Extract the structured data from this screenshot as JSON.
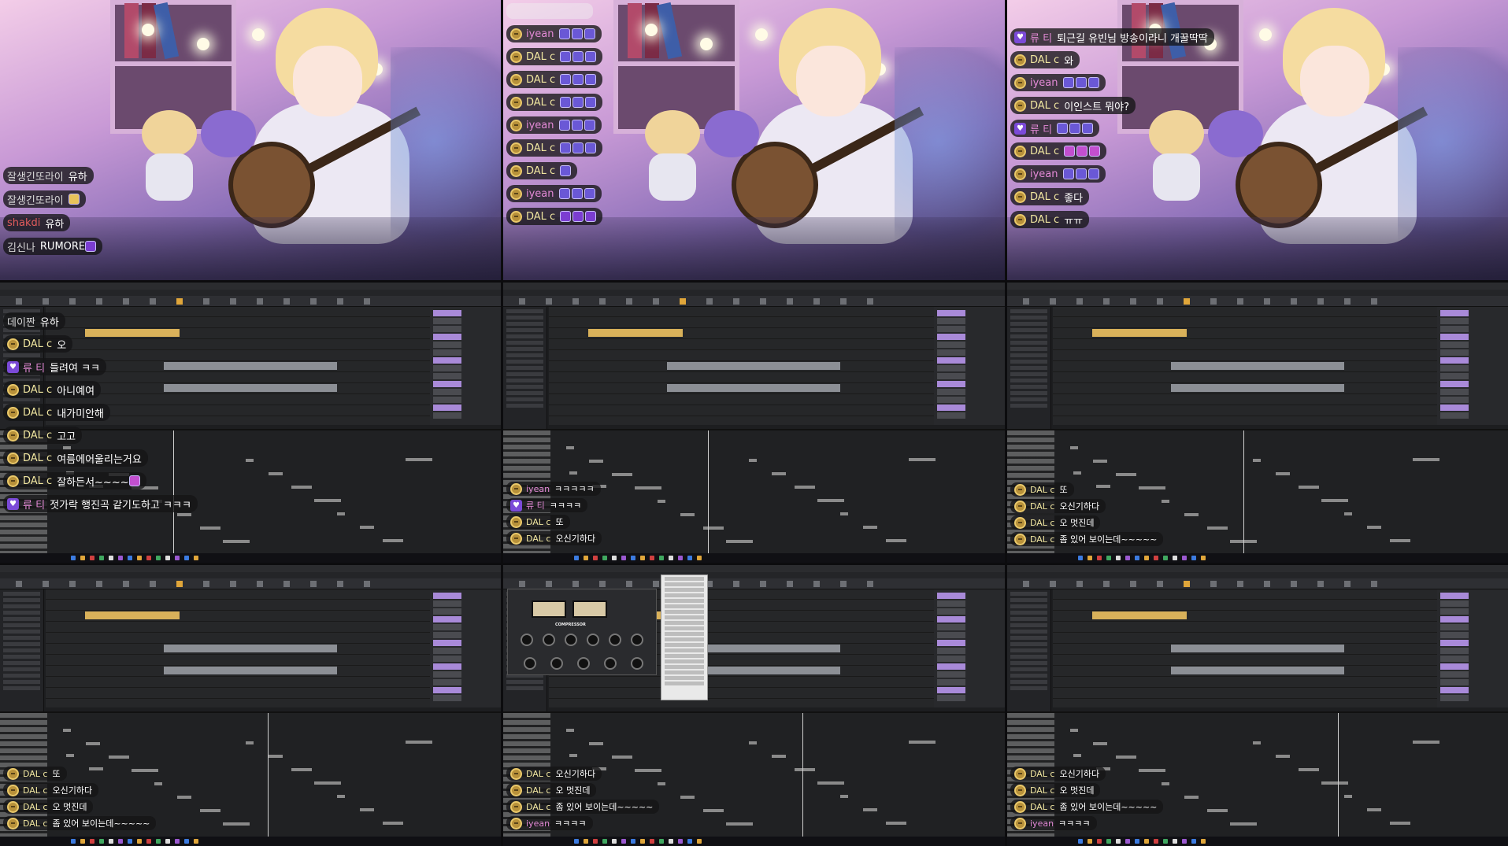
{
  "tiles": {
    "t1": {
      "chat": [
        {
          "nick": "잘생긴또라이",
          "text": "유하",
          "nick_color": "white"
        },
        {
          "nick": "잘생긴또라이",
          "text": "",
          "nick_color": "white",
          "emotes": [
            "yellow"
          ]
        },
        {
          "nick": "shakdi",
          "text": "유하",
          "nick_color": "red"
        },
        {
          "nick": "김신나",
          "text": "RUMORE",
          "nick_color": "white",
          "emotes": [
            "purple2"
          ]
        }
      ]
    },
    "t2": {
      "chat": [
        {
          "nick": "iyean",
          "text": "",
          "badge": true,
          "nick_color": "pink",
          "emotes": [
            "blue",
            "blue",
            "blue"
          ]
        },
        {
          "nick": "DAL c",
          "text": "",
          "badge": true,
          "emotes": [
            "blue",
            "blue",
            "blue"
          ]
        },
        {
          "nick": "DAL c",
          "text": "",
          "badge": true,
          "emotes": [
            "blue",
            "blue",
            "blue"
          ]
        },
        {
          "nick": "DAL c",
          "text": "",
          "badge": true,
          "emotes": [
            "blue",
            "blue",
            "blue"
          ]
        },
        {
          "nick": "iyean",
          "text": "",
          "badge": true,
          "nick_color": "pink",
          "emotes": [
            "blue",
            "blue",
            "blue"
          ]
        },
        {
          "nick": "DAL c",
          "text": "",
          "badge": true,
          "emotes": [
            "blue",
            "blue",
            "blue"
          ]
        },
        {
          "nick": "DAL c",
          "text": "",
          "badge": true,
          "emotes": [
            "blue"
          ]
        },
        {
          "nick": "iyean",
          "text": "",
          "badge": true,
          "nick_color": "pink",
          "emotes": [
            "blue",
            "blue",
            "blue"
          ]
        },
        {
          "nick": "DAL c",
          "text": "",
          "badge": true,
          "emotes": [
            "purple2",
            "purple2",
            "purple2"
          ]
        }
      ]
    },
    "t3": {
      "chat": [
        {
          "nick": "류 티",
          "text": "퇴근길 유빈님 방송이라니 개꿀딱딱",
          "heart": true,
          "nick_color": "pink"
        },
        {
          "nick": "DAL c",
          "text": "와",
          "badge": true
        },
        {
          "nick": "iyean",
          "text": "",
          "badge": true,
          "nick_color": "pink",
          "emotes": [
            "blue",
            "blue",
            "blue"
          ]
        },
        {
          "nick": "DAL c",
          "text": "이인스트 뭐야?",
          "badge": true
        },
        {
          "nick": "류 티",
          "text": "",
          "heart": true,
          "nick_color": "pink",
          "emotes": [
            "blue",
            "blue",
            "blue"
          ]
        },
        {
          "nick": "DAL c",
          "text": "",
          "badge": true,
          "emotes": [
            "pink",
            "pink",
            "pink"
          ]
        },
        {
          "nick": "iyean",
          "text": "",
          "badge": true,
          "nick_color": "pink",
          "emotes": [
            "blue",
            "blue",
            "blue"
          ]
        },
        {
          "nick": "DAL c",
          "text": "좋다",
          "badge": true
        },
        {
          "nick": "DAL c",
          "text": "ㅠㅠ",
          "badge": true
        }
      ]
    },
    "t4": {
      "chat": [
        {
          "nick": "데이짠",
          "text": "유하",
          "nick_color": "white"
        },
        {
          "nick": "DAL c",
          "text": "오",
          "badge": true
        },
        {
          "nick": "류 티",
          "text": "들려여 ㅋㅋ",
          "heart": true,
          "nick_color": "pink"
        },
        {
          "nick": "DAL c",
          "text": "아니예여",
          "badge": true
        },
        {
          "nick": "DAL c",
          "text": "내가미안해",
          "badge": true
        },
        {
          "nick": "DAL c",
          "text": "고고",
          "badge": true
        },
        {
          "nick": "DAL c",
          "text": "여름에어울리는거요",
          "badge": true
        },
        {
          "nick": "DAL c",
          "text": "잘하든서~~~~",
          "badge": true,
          "emotes": [
            "pink"
          ]
        },
        {
          "nick": "류 티",
          "text": "젓가락 행진곡 같기도하고 ㅋㅋㅋ",
          "heart": true,
          "nick_color": "pink"
        }
      ]
    },
    "t5": {
      "chat": [
        {
          "nick": "iyean",
          "text": "ㅋㅋㅋㅋㅋ",
          "badge": true,
          "nick_color": "pink"
        },
        {
          "nick": "류 티",
          "text": "ㅋㅋㅋㅋ",
          "heart": true,
          "nick_color": "pink"
        },
        {
          "nick": "DAL c",
          "text": "또",
          "badge": true
        },
        {
          "nick": "DAL c",
          "text": "오신기하다",
          "badge": true
        }
      ]
    },
    "t6": {
      "chat": [
        {
          "nick": "DAL c",
          "text": "또",
          "badge": true
        },
        {
          "nick": "DAL c",
          "text": "오신기하다",
          "badge": true
        },
        {
          "nick": "DAL c",
          "text": "오 멋진데",
          "badge": true
        },
        {
          "nick": "DAL c",
          "text": "좀 있어 보이는데~~~~~",
          "badge": true
        }
      ]
    },
    "t7": {
      "chat": [
        {
          "nick": "DAL c",
          "text": "또",
          "badge": true
        },
        {
          "nick": "DAL c",
          "text": "오신기하다",
          "badge": true
        },
        {
          "nick": "DAL c",
          "text": "오 멋진데",
          "badge": true
        },
        {
          "nick": "DAL c",
          "text": "좀 있어 보이는데~~~~~",
          "badge": true
        }
      ]
    },
    "t8": {
      "chat": [
        {
          "nick": "DAL c",
          "text": "오신기하다",
          "badge": true
        },
        {
          "nick": "DAL c",
          "text": "오 멋진데",
          "badge": true
        },
        {
          "nick": "DAL c",
          "text": "좀 있어 보이는데~~~~~",
          "badge": true
        },
        {
          "nick": "iyean",
          "text": "ㅋㅋㅋㅋ",
          "badge": true,
          "nick_color": "pink"
        }
      ]
    },
    "t9": {
      "chat": [
        {
          "nick": "DAL c",
          "text": "오신기하다",
          "badge": true
        },
        {
          "nick": "DAL c",
          "text": "오 멋진데",
          "badge": true
        },
        {
          "nick": "DAL c",
          "text": "좀 있어 보이는데~~~~~",
          "badge": true
        },
        {
          "nick": "iyean",
          "text": "ㅋㅋㅋㅋ",
          "badge": true,
          "nick_color": "pink"
        }
      ]
    }
  },
  "plugin": {
    "label": "COMPRESSOR"
  },
  "colors": {
    "clip_gold": "#d9b15a",
    "accent_purple": "#7b4ad8",
    "badge_gold": "#b8913a"
  }
}
